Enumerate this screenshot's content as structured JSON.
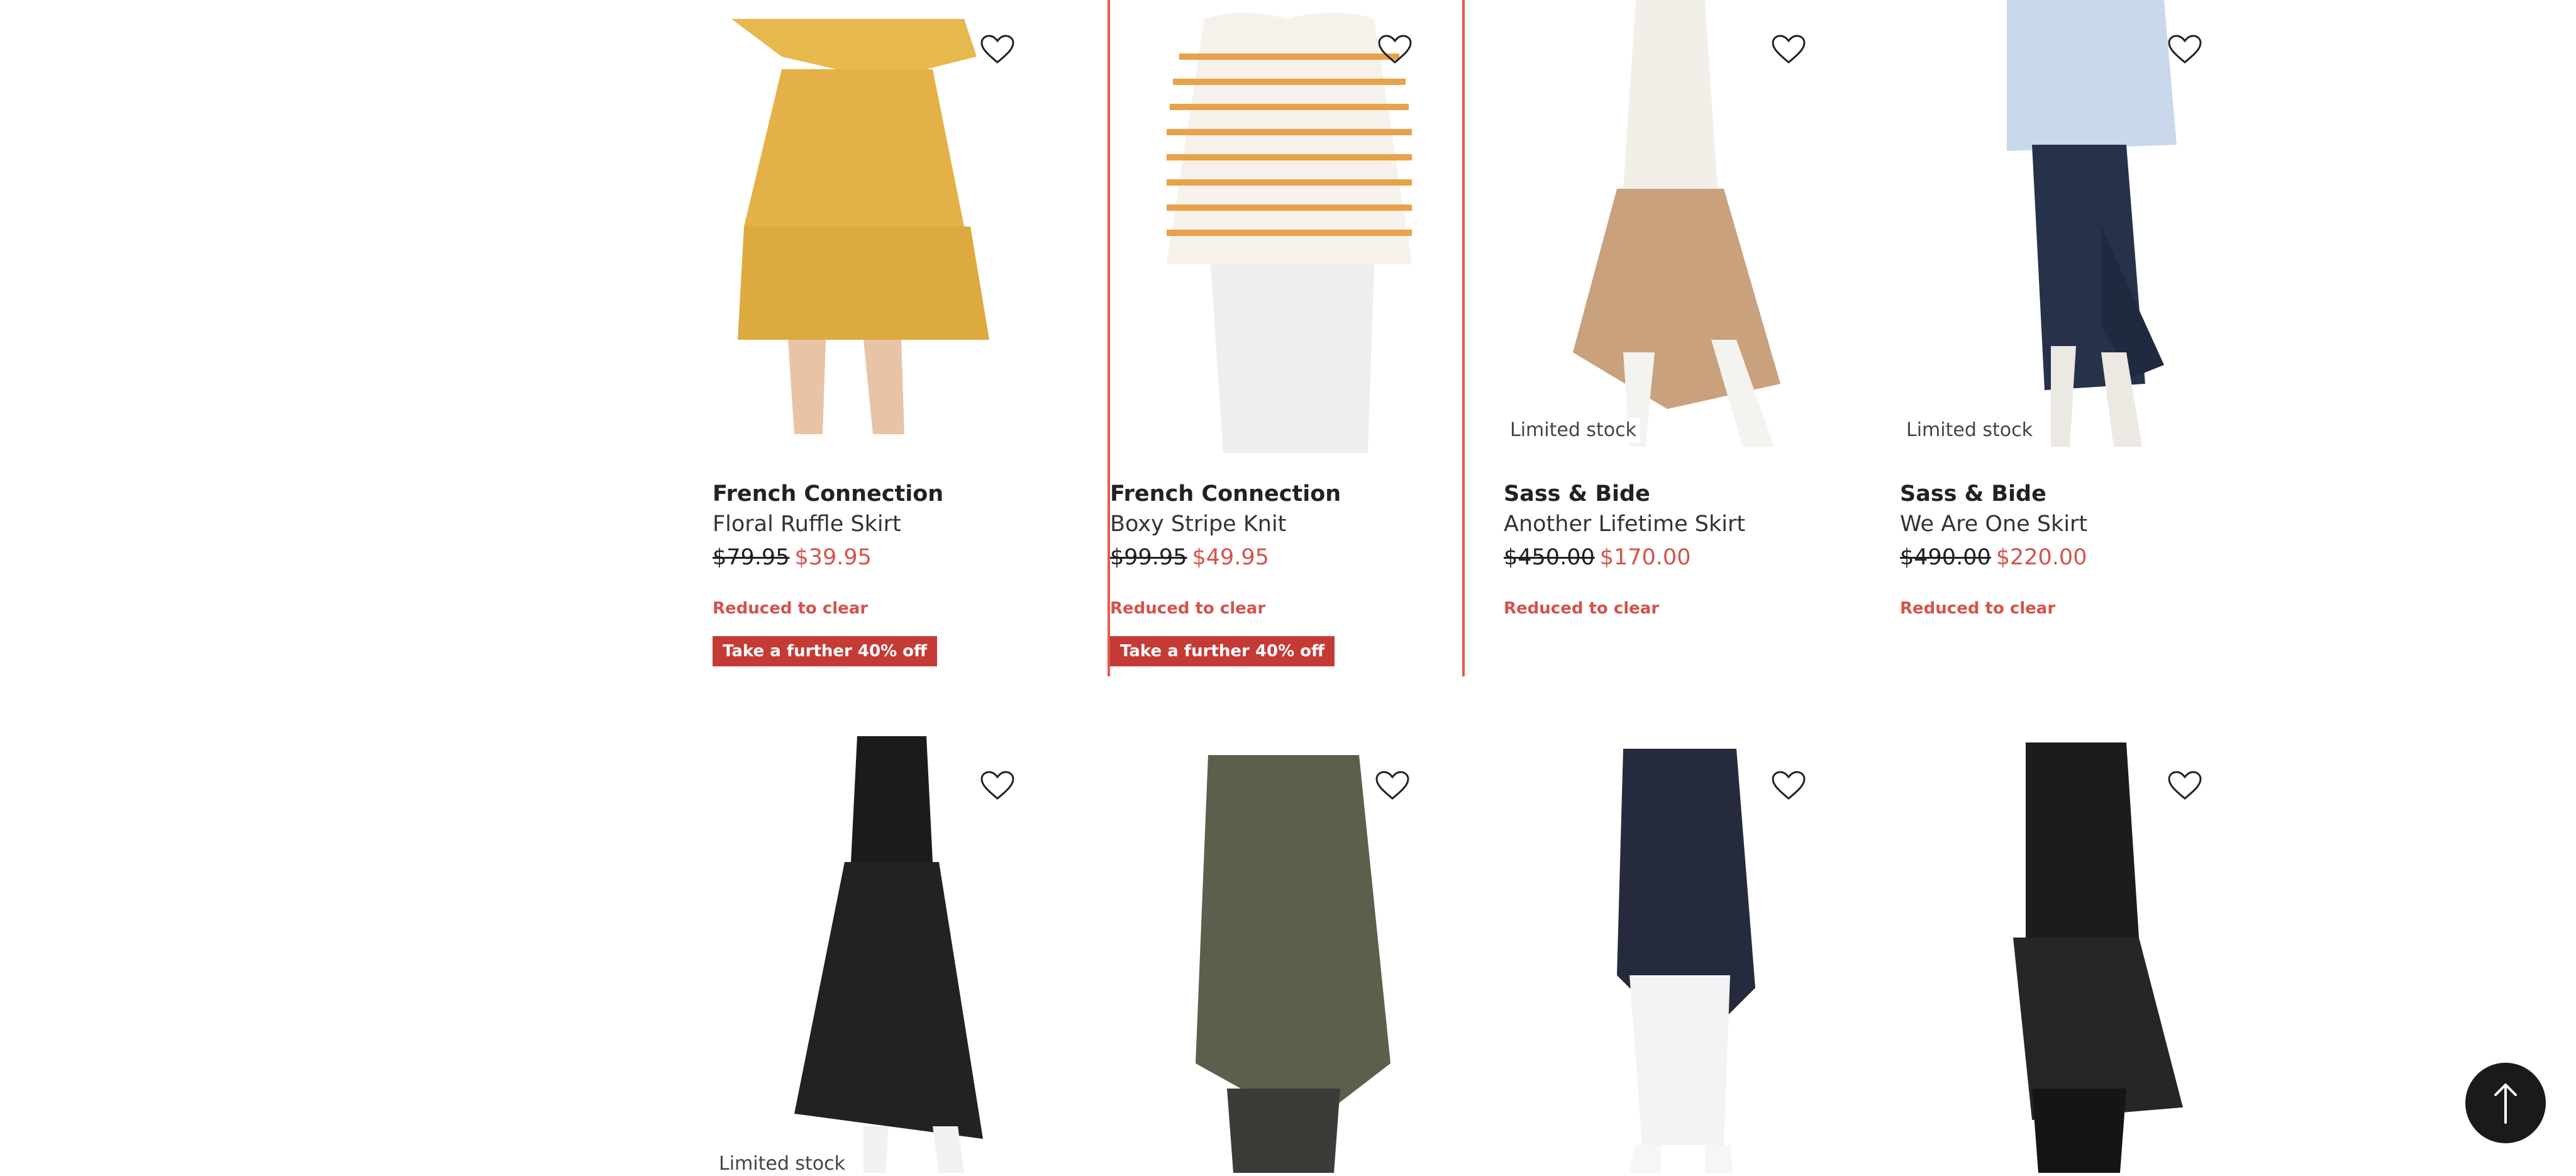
{
  "products": [
    {
      "brand": "French Connection",
      "name": "Floral Ruffle Skirt",
      "was": "$79.95",
      "now": "$39.95",
      "badge": "",
      "reduced": "Reduced to clear",
      "promo": "Take a further 40% off",
      "image": "yellow-ruffle-skirt"
    },
    {
      "brand": "French Connection",
      "name": "Boxy Stripe Knit",
      "was": "$99.95",
      "now": "$49.95",
      "badge": "",
      "reduced": "Reduced to clear",
      "promo": "Take a further 40% off",
      "image": "stripe-knit"
    },
    {
      "brand": "Sass & Bide",
      "name": "Another Lifetime Skirt",
      "was": "$450.00",
      "now": "$170.00",
      "badge": "Limited stock",
      "reduced": "Reduced to clear",
      "promo": "",
      "image": "camel-skirt"
    },
    {
      "brand": "Sass & Bide",
      "name": "We Are One Skirt",
      "was": "$490.00",
      "now": "$220.00",
      "badge": "Limited stock",
      "reduced": "Reduced to clear",
      "promo": "",
      "image": "navy-ruffle-skirt"
    },
    {
      "badge": "Limited stock",
      "image": "black-dress"
    },
    {
      "badge": "",
      "image": "olive-top"
    },
    {
      "badge": "",
      "image": "navy-top"
    },
    {
      "badge": "",
      "image": "black-ruffle-top"
    }
  ],
  "icons": {
    "favorite": "heart-outline-icon",
    "back_to_top": "arrow-up-icon"
  },
  "colors": {
    "sale": "#d4534b",
    "promo_bg": "#c43b36",
    "selected_outline": "#e8574f"
  }
}
